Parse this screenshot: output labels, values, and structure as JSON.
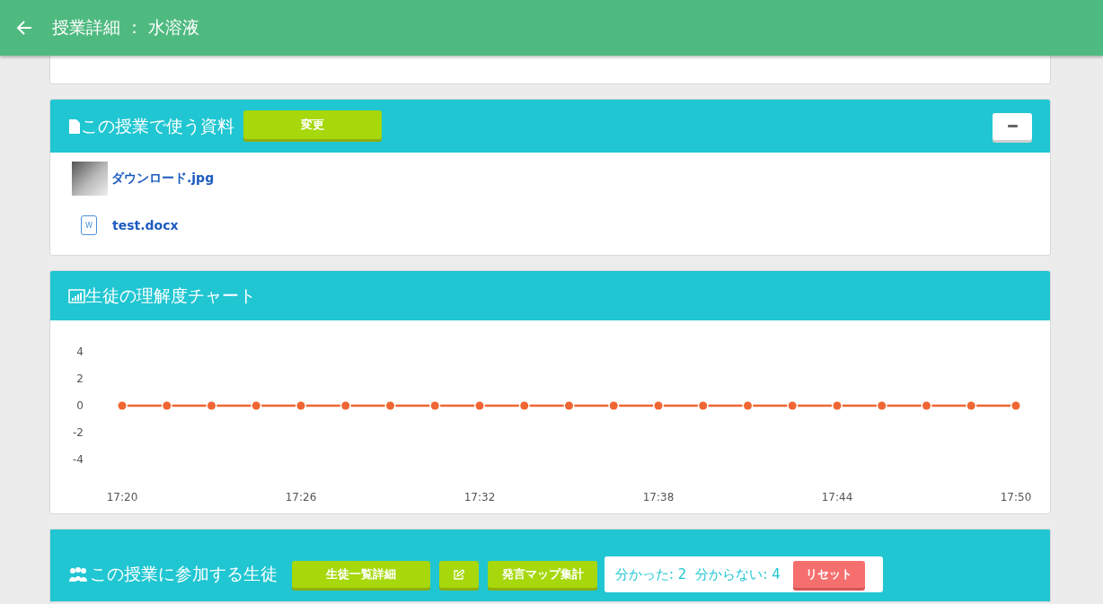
{
  "header": {
    "title": "授業詳細 ： 水溶液"
  },
  "materials": {
    "title": "この授業で使う資料",
    "change_button": "変更",
    "files": [
      {
        "kind": "image",
        "name": "ダウンロード.jpg"
      },
      {
        "kind": "word",
        "name": "test.docx",
        "icon_text": "W"
      }
    ]
  },
  "chart": {
    "title": "生徒の理解度チャート",
    "chart_data": {
      "type": "line",
      "categories": [
        "17:20",
        null,
        null,
        null,
        "17:26",
        null,
        null,
        null,
        "17:32",
        null,
        null,
        null,
        "17:38",
        null,
        null,
        null,
        "17:44",
        null,
        null,
        null,
        "17:50"
      ],
      "series": [
        {
          "color": "#ef6632",
          "marker": "circle",
          "values": [
            0,
            0,
            0,
            0,
            0,
            0,
            0,
            0,
            0,
            0,
            0,
            0,
            0,
            0,
            0,
            0,
            0,
            0,
            0,
            0,
            0
          ]
        }
      ],
      "ylim": [
        -4,
        4
      ],
      "yticks": [
        4,
        2,
        0,
        -2,
        -4
      ]
    }
  },
  "students": {
    "title": "この授業に参加する生徒",
    "buttons": [
      {
        "kind": "text",
        "label": "生徒一覧詳細"
      },
      {
        "kind": "icon"
      },
      {
        "kind": "text",
        "label": "発言マップ集計"
      }
    ],
    "understood": "分かった: 2",
    "not_understood": "分からない: 4",
    "reset_button": "リセット"
  }
}
